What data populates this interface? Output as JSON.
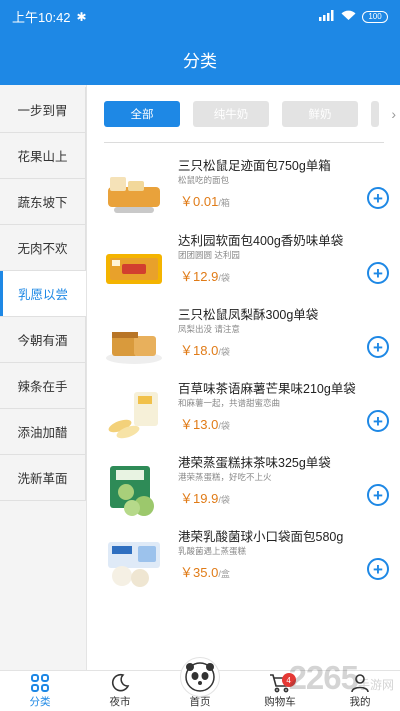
{
  "status_bar": {
    "time": "上午10:42",
    "battery": "100"
  },
  "nav": {
    "title": "分类"
  },
  "sidebar": {
    "items": [
      {
        "label": "一步到胃"
      },
      {
        "label": "花果山上"
      },
      {
        "label": "蔬东坡下"
      },
      {
        "label": "无肉不欢"
      },
      {
        "label": "乳愿以尝",
        "active": true
      },
      {
        "label": "今朝有酒"
      },
      {
        "label": "辣条在手"
      },
      {
        "label": "添油加醋"
      },
      {
        "label": "洗新革面"
      }
    ]
  },
  "filters": {
    "chips": [
      "全部",
      "纯牛奶",
      "鲜奶"
    ],
    "active_index": 0,
    "more_icon": "chevron-right-icon"
  },
  "products": [
    {
      "name": "三只松鼠足迹面包750g单箱",
      "desc": "松鼠吃的面包",
      "price": "￥0.01",
      "unit": "/箱"
    },
    {
      "name": "达利园软面包400g香奶味单袋",
      "desc": "团团圆圆 达利园",
      "price": "￥12.9",
      "unit": "/袋"
    },
    {
      "name": "三只松鼠凤梨酥300g单袋",
      "desc": "凤梨出没 请注意",
      "price": "￥18.0",
      "unit": "/袋"
    },
    {
      "name": "百草味茶语麻薯芒果味210g单袋",
      "desc": "和麻薯一起，共谱甜蜜恋曲",
      "price": "￥13.0",
      "unit": "/袋"
    },
    {
      "name": "港荣蒸蛋糕抹茶味325g单袋",
      "desc": "港荣蒸蛋糕，好吃不上火",
      "price": "￥19.9",
      "unit": "/袋"
    },
    {
      "name": "港荣乳酸菌球小口袋面包580g",
      "desc": "乳酸菌遇上蒸蛋糕",
      "price": "￥35.0",
      "unit": "/盒"
    }
  ],
  "tabbar": {
    "items": [
      {
        "label": "分类",
        "icon": "grid-icon",
        "active": true
      },
      {
        "label": "夜市",
        "icon": "moon-icon"
      },
      {
        "label": "首页",
        "icon": "panda-icon"
      },
      {
        "label": "购物车",
        "icon": "cart-icon",
        "badge": "4"
      },
      {
        "label": "我的",
        "icon": "user-icon"
      }
    ]
  },
  "watermark": {
    "brand": "2265",
    "suffix": "手游网",
    "url": ".com"
  },
  "colors": {
    "primary": "#1e88e5",
    "price": "#e07b17",
    "badge": "#e53935"
  }
}
